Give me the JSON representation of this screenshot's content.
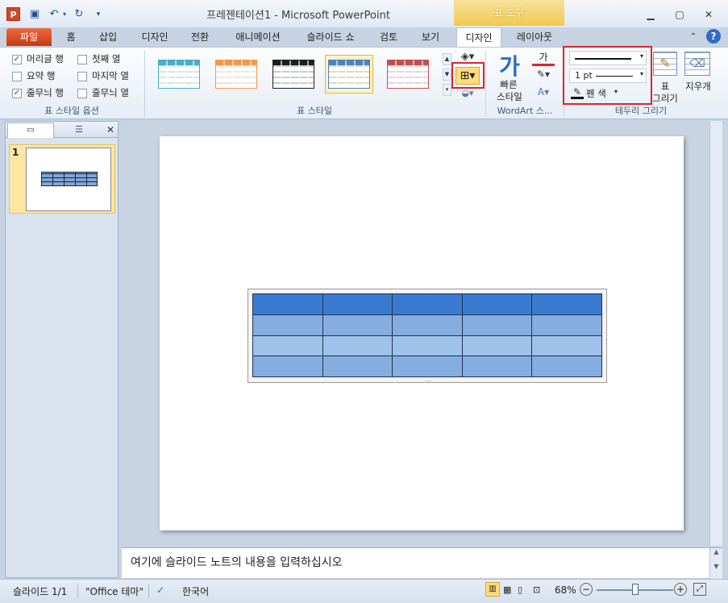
{
  "title_bar": {
    "title": "프레젠테이션1 - Microsoft PowerPoint",
    "tool_tab": "표 도구",
    "app_icon_letter": "P"
  },
  "ribbon_tabs": [
    "파일",
    "홈",
    "삽입",
    "디자인",
    "전환",
    "애니메이션",
    "슬라이드 쇼",
    "검토",
    "보기",
    "디자인",
    "레이아웃"
  ],
  "table_style_options": {
    "items": [
      {
        "label": "머리글 행",
        "checked": true
      },
      {
        "label": "첫째 열",
        "checked": false
      },
      {
        "label": "요약 행",
        "checked": false
      },
      {
        "label": "마지막 열",
        "checked": false
      },
      {
        "label": "줄무늬 행",
        "checked": true
      },
      {
        "label": "줄무늬 열",
        "checked": false
      }
    ],
    "group_label": "표 스타일 옵션"
  },
  "table_styles": {
    "group_label": "표 스타일",
    "thumbs": [
      {
        "color": "#4bacc6"
      },
      {
        "color": "#f79646"
      },
      {
        "color": "#1e1e1e"
      },
      {
        "color": "#4f81bd"
      },
      {
        "color": "#c0504d"
      }
    ],
    "selected_index": 3
  },
  "wordart": {
    "quick_styles_label1": "빠른",
    "quick_styles_label2": "스타일",
    "group_label": "WordArt 스...",
    "glyph": "가",
    "glyph_small": "가"
  },
  "draw_borders": {
    "weight_label": "1 pt",
    "pen_color_label": "펜 색",
    "draw_table_label1": "표",
    "draw_table_label2": "그리기",
    "eraser_label": "지우개",
    "group_label": "테두리 그리기"
  },
  "slide_panel": {
    "slide_number": "1"
  },
  "notes": {
    "placeholder": "여기에 슬라이드 노트의 내용을 입력하십시오"
  },
  "status_bar": {
    "slide_count": "슬라이드 1/1",
    "theme": "\"Office 테마\"",
    "language": "한국어",
    "zoom": "68%",
    "zoom_fraction": 0.5
  },
  "colors": {
    "header_blue": "#3a7bd0",
    "band_light": "#9fc2ea",
    "band_mid": "#86ade0",
    "accent_red": "#d8262e"
  }
}
